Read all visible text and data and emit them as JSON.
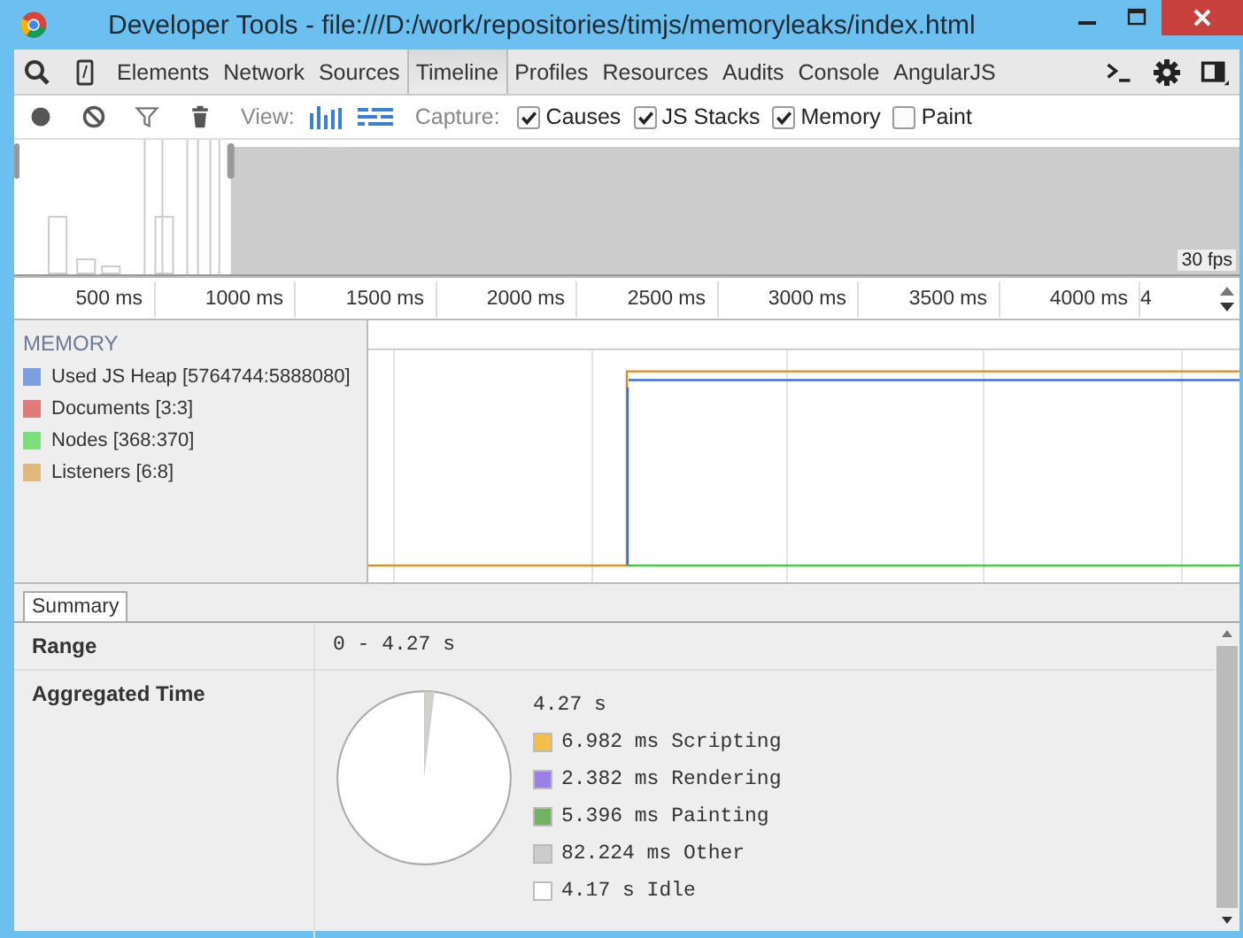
{
  "window": {
    "title": "Developer Tools - file:///D:/work/repositories/timjs/memoryleaks/index.html"
  },
  "tabs": [
    {
      "label": "Elements",
      "selected": false
    },
    {
      "label": "Network",
      "selected": false
    },
    {
      "label": "Sources",
      "selected": false
    },
    {
      "label": "Timeline",
      "selected": true
    },
    {
      "label": "Profiles",
      "selected": false
    },
    {
      "label": "Resources",
      "selected": false
    },
    {
      "label": "Audits",
      "selected": false
    },
    {
      "label": "Console",
      "selected": false
    },
    {
      "label": "AngularJS",
      "selected": false
    }
  ],
  "toolbar": {
    "view_label": "View:",
    "capture_label": "Capture:",
    "options": [
      {
        "label": "Causes",
        "checked": true
      },
      {
        "label": "JS Stacks",
        "checked": true
      },
      {
        "label": "Memory",
        "checked": true
      },
      {
        "label": "Paint",
        "checked": false
      }
    ]
  },
  "overview": {
    "fps": "30 fps"
  },
  "ruler": {
    "ticks": [
      "500 ms",
      "1000 ms",
      "1500 ms",
      "2000 ms",
      "2500 ms",
      "3000 ms",
      "3500 ms",
      "4000 ms",
      "4"
    ]
  },
  "memory": {
    "heading": "MEMORY",
    "counters": [
      {
        "label": "Used JS Heap [5764744:5888080]",
        "color": "#7b9fe0"
      },
      {
        "label": "Documents [3:3]",
        "color": "#e07b7b"
      },
      {
        "label": "Nodes [368:370]",
        "color": "#7be07b"
      },
      {
        "label": "Listeners [6:8]",
        "color": "#e0b87b"
      }
    ]
  },
  "summary": {
    "tabs": [
      {
        "label": "Summary",
        "selected": true
      }
    ],
    "range_label": "Range",
    "range_value": "0 - 4.27 s",
    "aggregated_label": "Aggregated Time",
    "total": "4.27 s",
    "legend": [
      {
        "text": "6.982 ms Scripting",
        "color": "#f2c04a"
      },
      {
        "text": "2.382 ms Rendering",
        "color": "#9b7fe6"
      },
      {
        "text": "5.396 ms Painting",
        "color": "#71b363"
      },
      {
        "text": "82.224 ms Other",
        "color": "#cccccc"
      },
      {
        "text": "4.17 s Idle",
        "color": "#ffffff"
      }
    ]
  }
}
